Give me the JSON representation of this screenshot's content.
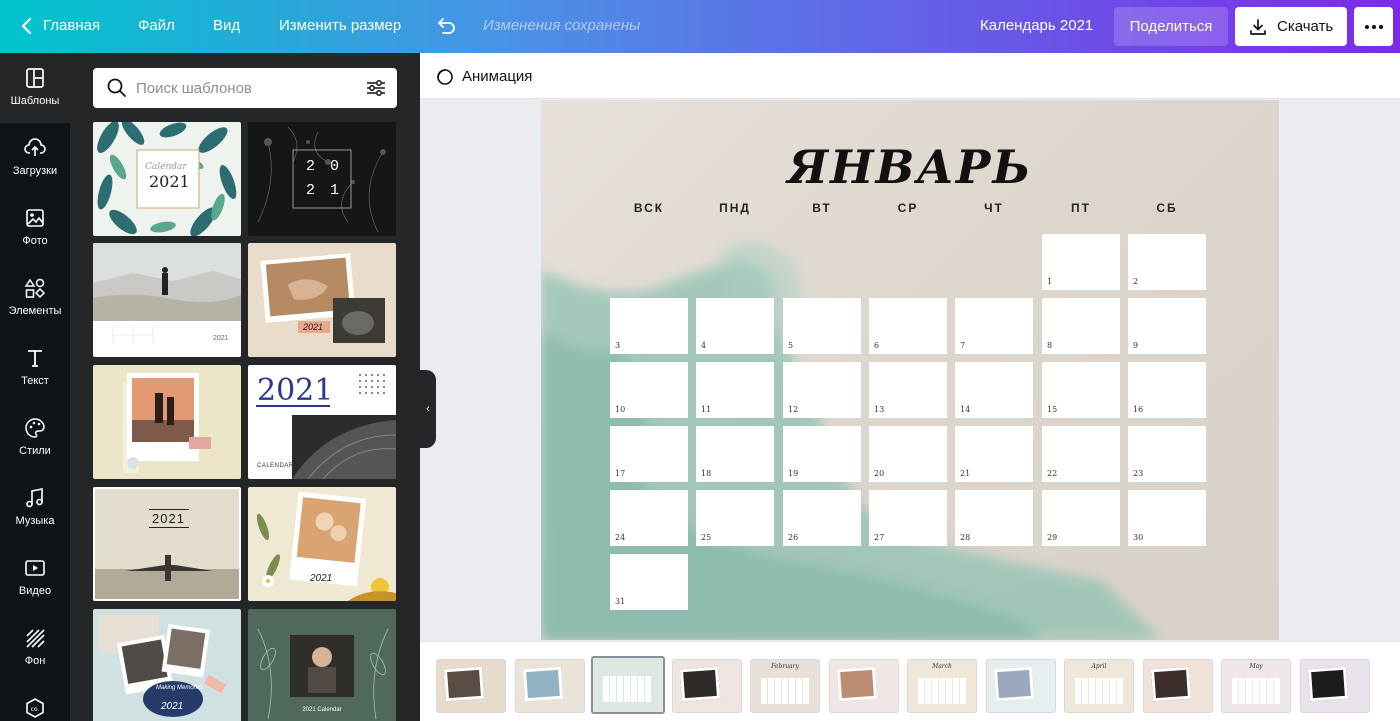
{
  "header": {
    "home_label": "Главная",
    "file_label": "Файл",
    "view_label": "Вид",
    "resize_label": "Изменить размер",
    "saved_status": "Изменения сохранены",
    "doc_title": "Календарь 2021",
    "share_label": "Поделиться",
    "download_label": "Скачать"
  },
  "sidebar": {
    "items": [
      {
        "label": "Шаблоны",
        "icon": "templates-icon"
      },
      {
        "label": "Загрузки",
        "icon": "upload-icon"
      },
      {
        "label": "Фото",
        "icon": "photo-icon"
      },
      {
        "label": "Элементы",
        "icon": "elements-icon"
      },
      {
        "label": "Текст",
        "icon": "text-icon"
      },
      {
        "label": "Стили",
        "icon": "palette-icon"
      },
      {
        "label": "Музыка",
        "icon": "music-icon"
      },
      {
        "label": "Видео",
        "icon": "video-icon"
      },
      {
        "label": "Фон",
        "icon": "background-icon"
      },
      {
        "label": "",
        "icon": "apps-icon"
      }
    ]
  },
  "templates_panel": {
    "search_placeholder": "Поиск шаблонов",
    "thumbs": {
      "t1_year": "2021",
      "t1_script": "Calendar",
      "t2_year_top": "2 0",
      "t2_year_bottom": "2 1",
      "t3_year": "2021",
      "t4_year": "2021",
      "t6_year": "2021",
      "t6_caption": "CALENDAR",
      "t7_year": "2021",
      "t8_year": "2021",
      "t9_script": "Making Memories",
      "t9_year": "2021",
      "t10_caption": "2021 Calendar"
    }
  },
  "toolbar": {
    "animation_label": "Анимация"
  },
  "canvas": {
    "month": "ЯНВАРЬ",
    "weekdays": [
      "ВСК",
      "ПНД",
      "ВТ",
      "СР",
      "ЧТ",
      "ПТ",
      "СБ"
    ],
    "first_weekday_index": 5,
    "days_in_month": 31
  },
  "filmstrip": {
    "thumbs": [
      "",
      "",
      "",
      "",
      "February",
      "",
      "March",
      "",
      "April",
      "",
      "May",
      ""
    ],
    "active_index": 2
  },
  "colors": {
    "header_start": "#00c4cc",
    "header_end": "#7d2ae8",
    "rail_bg": "#0e1318",
    "panel_bg": "#252627",
    "watercolor": "#8fc2b2"
  }
}
